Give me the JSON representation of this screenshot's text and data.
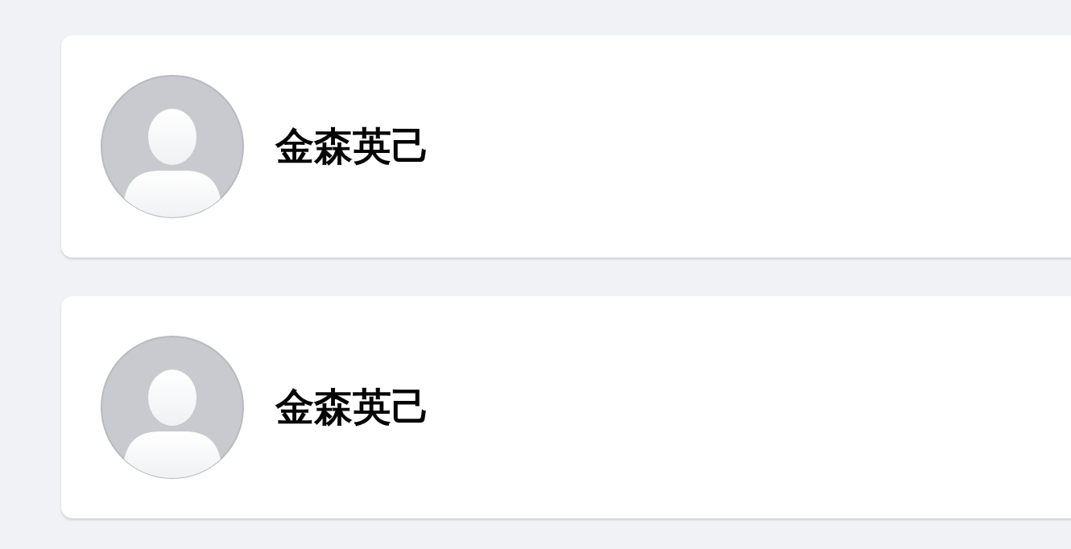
{
  "people": [
    {
      "name": "金森英己"
    },
    {
      "name": "金森英己"
    }
  ]
}
